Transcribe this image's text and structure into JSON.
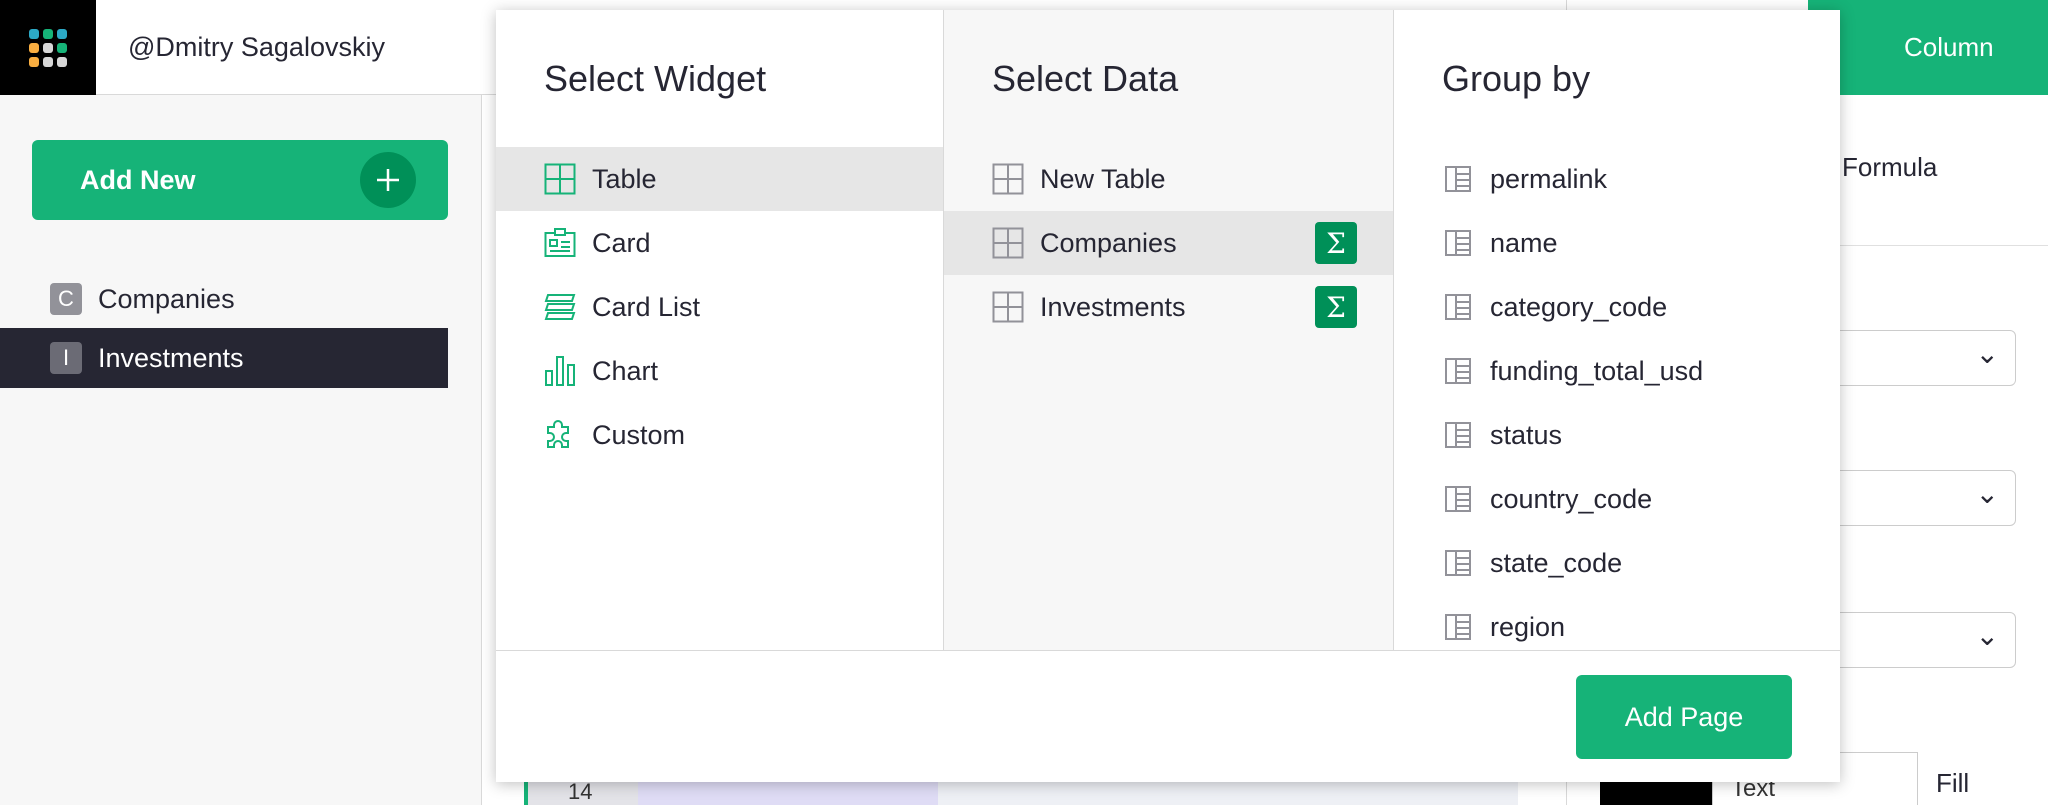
{
  "app": {
    "user_name": "@Dmitry Sagalovskiy",
    "add_new_label": "Add New",
    "pages": [
      {
        "initial": "C",
        "label": "Companies",
        "active": false
      },
      {
        "initial": "I",
        "label": "Investments",
        "active": true
      }
    ],
    "right_panel": {
      "column_tab_label": "Column",
      "formula_label": "Formula",
      "fill_label": "Fill",
      "text_label": "Text"
    },
    "grid_row_number": "14"
  },
  "modal": {
    "select_widget": {
      "title": "Select Widget",
      "items": [
        {
          "label": "Table",
          "icon": "table-widget-icon",
          "selected": true
        },
        {
          "label": "Card",
          "icon": "card-widget-icon",
          "selected": false
        },
        {
          "label": "Card List",
          "icon": "card-list-widget-icon",
          "selected": false
        },
        {
          "label": "Chart",
          "icon": "chart-widget-icon",
          "selected": false
        },
        {
          "label": "Custom",
          "icon": "custom-widget-icon",
          "selected": false
        }
      ]
    },
    "select_data": {
      "title": "Select Data",
      "items": [
        {
          "label": "New Table",
          "icon": "table-icon",
          "selected": false,
          "summary": false
        },
        {
          "label": "Companies",
          "icon": "table-icon",
          "selected": true,
          "summary": true
        },
        {
          "label": "Investments",
          "icon": "table-icon",
          "selected": false,
          "summary": true
        }
      ],
      "summary_symbol": "Σ"
    },
    "group_by": {
      "title": "Group by",
      "items": [
        "permalink",
        "name",
        "category_code",
        "funding_total_usd",
        "status",
        "country_code",
        "state_code",
        "region"
      ]
    },
    "add_page_label": "Add Page"
  },
  "colors": {
    "brand_green": "#16b378",
    "dark_green": "#009058",
    "sidebar_active": "#262633"
  }
}
